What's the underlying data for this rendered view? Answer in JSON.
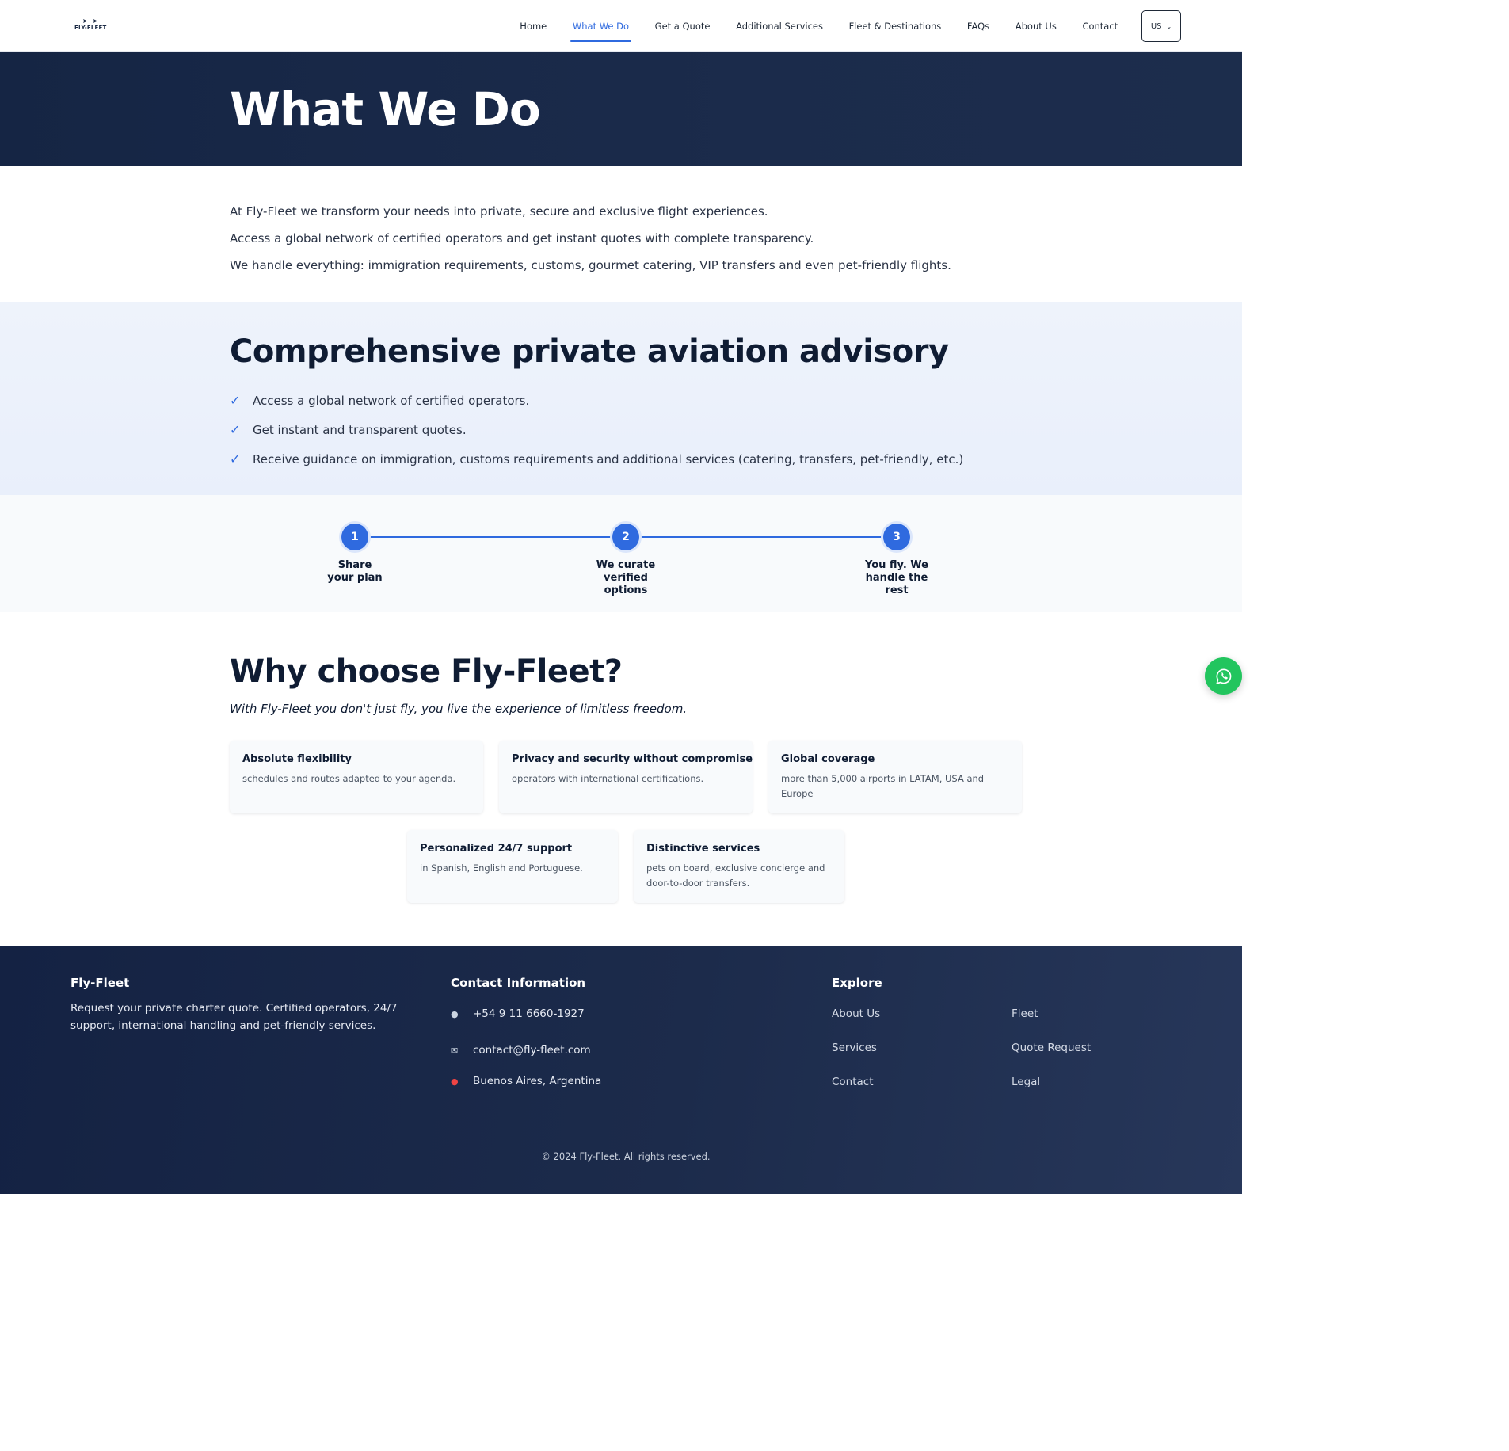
{
  "brand": {
    "logo_text": "FLY-FLEET"
  },
  "nav": {
    "items": [
      "Home",
      "What We Do",
      "Get a Quote",
      "Additional Services",
      "Fleet & Destinations",
      "FAQs",
      "About Us",
      "Contact"
    ],
    "active": "What We Do",
    "language": "US"
  },
  "hero": {
    "title": "What We Do"
  },
  "intro": {
    "paragraphs": [
      "At Fly-Fleet we transform your needs into private, secure and exclusive flight experiences.",
      "Access a global network of certified operators and get instant quotes with complete transparency.",
      "We handle everything: immigration requirements, customs, gourmet catering, VIP transfers and even pet-friendly flights."
    ]
  },
  "advisory": {
    "title": "Comprehensive private aviation advisory",
    "items": [
      "Access a global network of certified operators.",
      "Get instant and transparent quotes.",
      "Receive guidance on immigration, customs requirements and additional services (catering, transfers, pet-friendly, etc.)"
    ]
  },
  "steps": [
    {
      "number": "1",
      "label": "Share your plan"
    },
    {
      "number": "2",
      "label": "We curate verified options"
    },
    {
      "number": "3",
      "label": "You fly. We handle the rest"
    }
  ],
  "why": {
    "title": "Why choose Fly-Fleet?",
    "subtitle": "With Fly-Fleet you don't just fly, you live the experience of limitless freedom.",
    "cards": [
      {
        "title": "Absolute flexibility",
        "desc": "schedules and routes adapted to your agenda."
      },
      {
        "title": "Privacy and security without compromise",
        "desc": "operators with international certifications."
      },
      {
        "title": "Global coverage",
        "desc": "more than 5,000 airports in LATAM, USA and Europe"
      },
      {
        "title": "Personalized 24/7 support",
        "desc": "in Spanish, English and Portuguese."
      },
      {
        "title": "Distinctive services",
        "desc": "pets on board, exclusive concierge and door-to-door transfers."
      }
    ]
  },
  "footer": {
    "brand_title": "Fly-Fleet",
    "brand_text": "Request your private charter quote. Certified operators, 24/7 support, international handling and pet-friendly services.",
    "contact_title": "Contact Information",
    "phone": "+54 9 11 6660-1927",
    "email": "contact@fly-fleet.com",
    "location": "Buenos Aires, Argentina",
    "explore_title": "Explore",
    "explore_links": [
      "About Us",
      "Fleet",
      "Services",
      "Quote Request",
      "Contact",
      "Legal"
    ],
    "copyright": "© 2024 Fly-Fleet. All rights reserved."
  },
  "colors": {
    "accent": "#2f6adf",
    "navy": "#152544",
    "whatsapp": "#22c55e"
  }
}
